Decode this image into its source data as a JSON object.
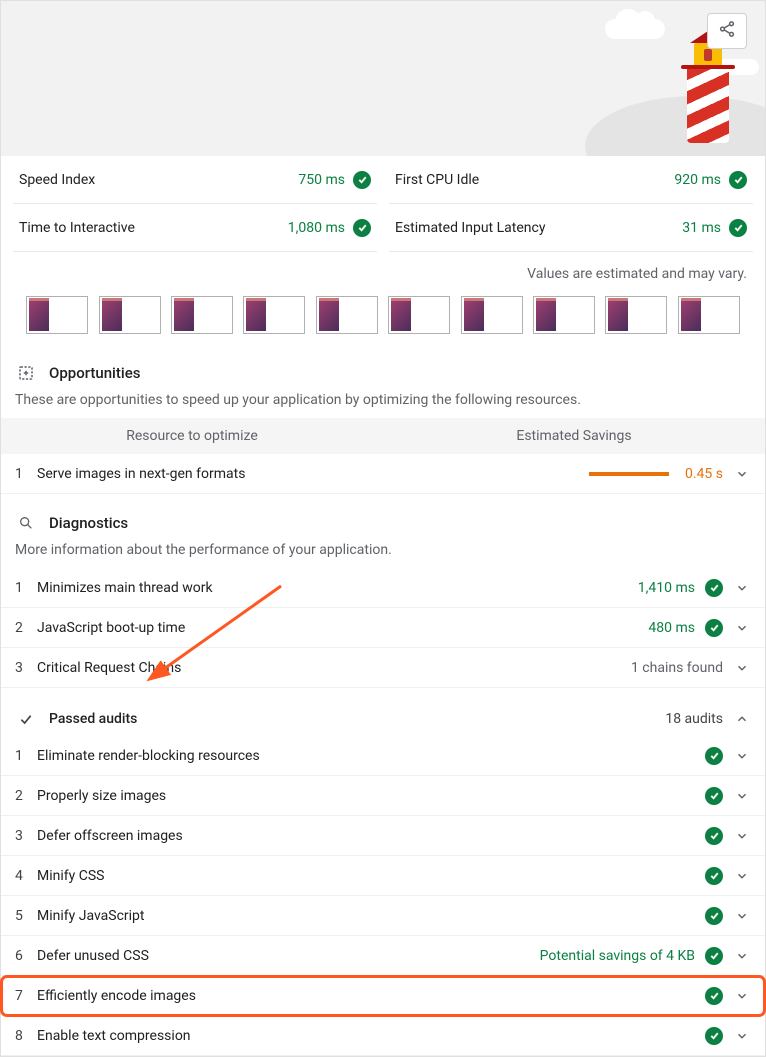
{
  "metrics": {
    "left": [
      {
        "label": "Speed Index",
        "value": "750 ms"
      },
      {
        "label": "Time to Interactive",
        "value": "1,080 ms"
      }
    ],
    "right": [
      {
        "label": "First CPU Idle",
        "value": "920 ms"
      },
      {
        "label": "Estimated Input Latency",
        "value": "31 ms"
      }
    ]
  },
  "estimated_note": "Values are estimated and may vary.",
  "opportunities": {
    "title": "Opportunities",
    "desc": "These are opportunities to speed up your application by optimizing the following resources.",
    "col_left": "Resource to optimize",
    "col_right": "Estimated Savings",
    "items": [
      {
        "num": "1",
        "title": "Serve images in next-gen formats",
        "savings": "0.45 s"
      }
    ]
  },
  "diagnostics": {
    "title": "Diagnostics",
    "desc": "More information about the performance of your application.",
    "items": [
      {
        "num": "1",
        "title": "Minimizes main thread work",
        "value": "1,410 ms",
        "pass": true
      },
      {
        "num": "2",
        "title": "JavaScript boot-up time",
        "value": "480 ms",
        "pass": true
      },
      {
        "num": "3",
        "title": "Critical Request Chains",
        "value": "1 chains found",
        "pass": false
      }
    ]
  },
  "passed": {
    "title": "Passed audits",
    "count": "18 audits",
    "items": [
      {
        "num": "1",
        "title": "Eliminate render-blocking resources",
        "note": ""
      },
      {
        "num": "2",
        "title": "Properly size images",
        "note": ""
      },
      {
        "num": "3",
        "title": "Defer offscreen images",
        "note": ""
      },
      {
        "num": "4",
        "title": "Minify CSS",
        "note": ""
      },
      {
        "num": "5",
        "title": "Minify JavaScript",
        "note": ""
      },
      {
        "num": "6",
        "title": "Defer unused CSS",
        "note": "Potential savings of 4 KB"
      },
      {
        "num": "7",
        "title": "Efficiently encode images",
        "note": "",
        "highlight": true
      },
      {
        "num": "8",
        "title": "Enable text compression",
        "note": ""
      }
    ]
  }
}
